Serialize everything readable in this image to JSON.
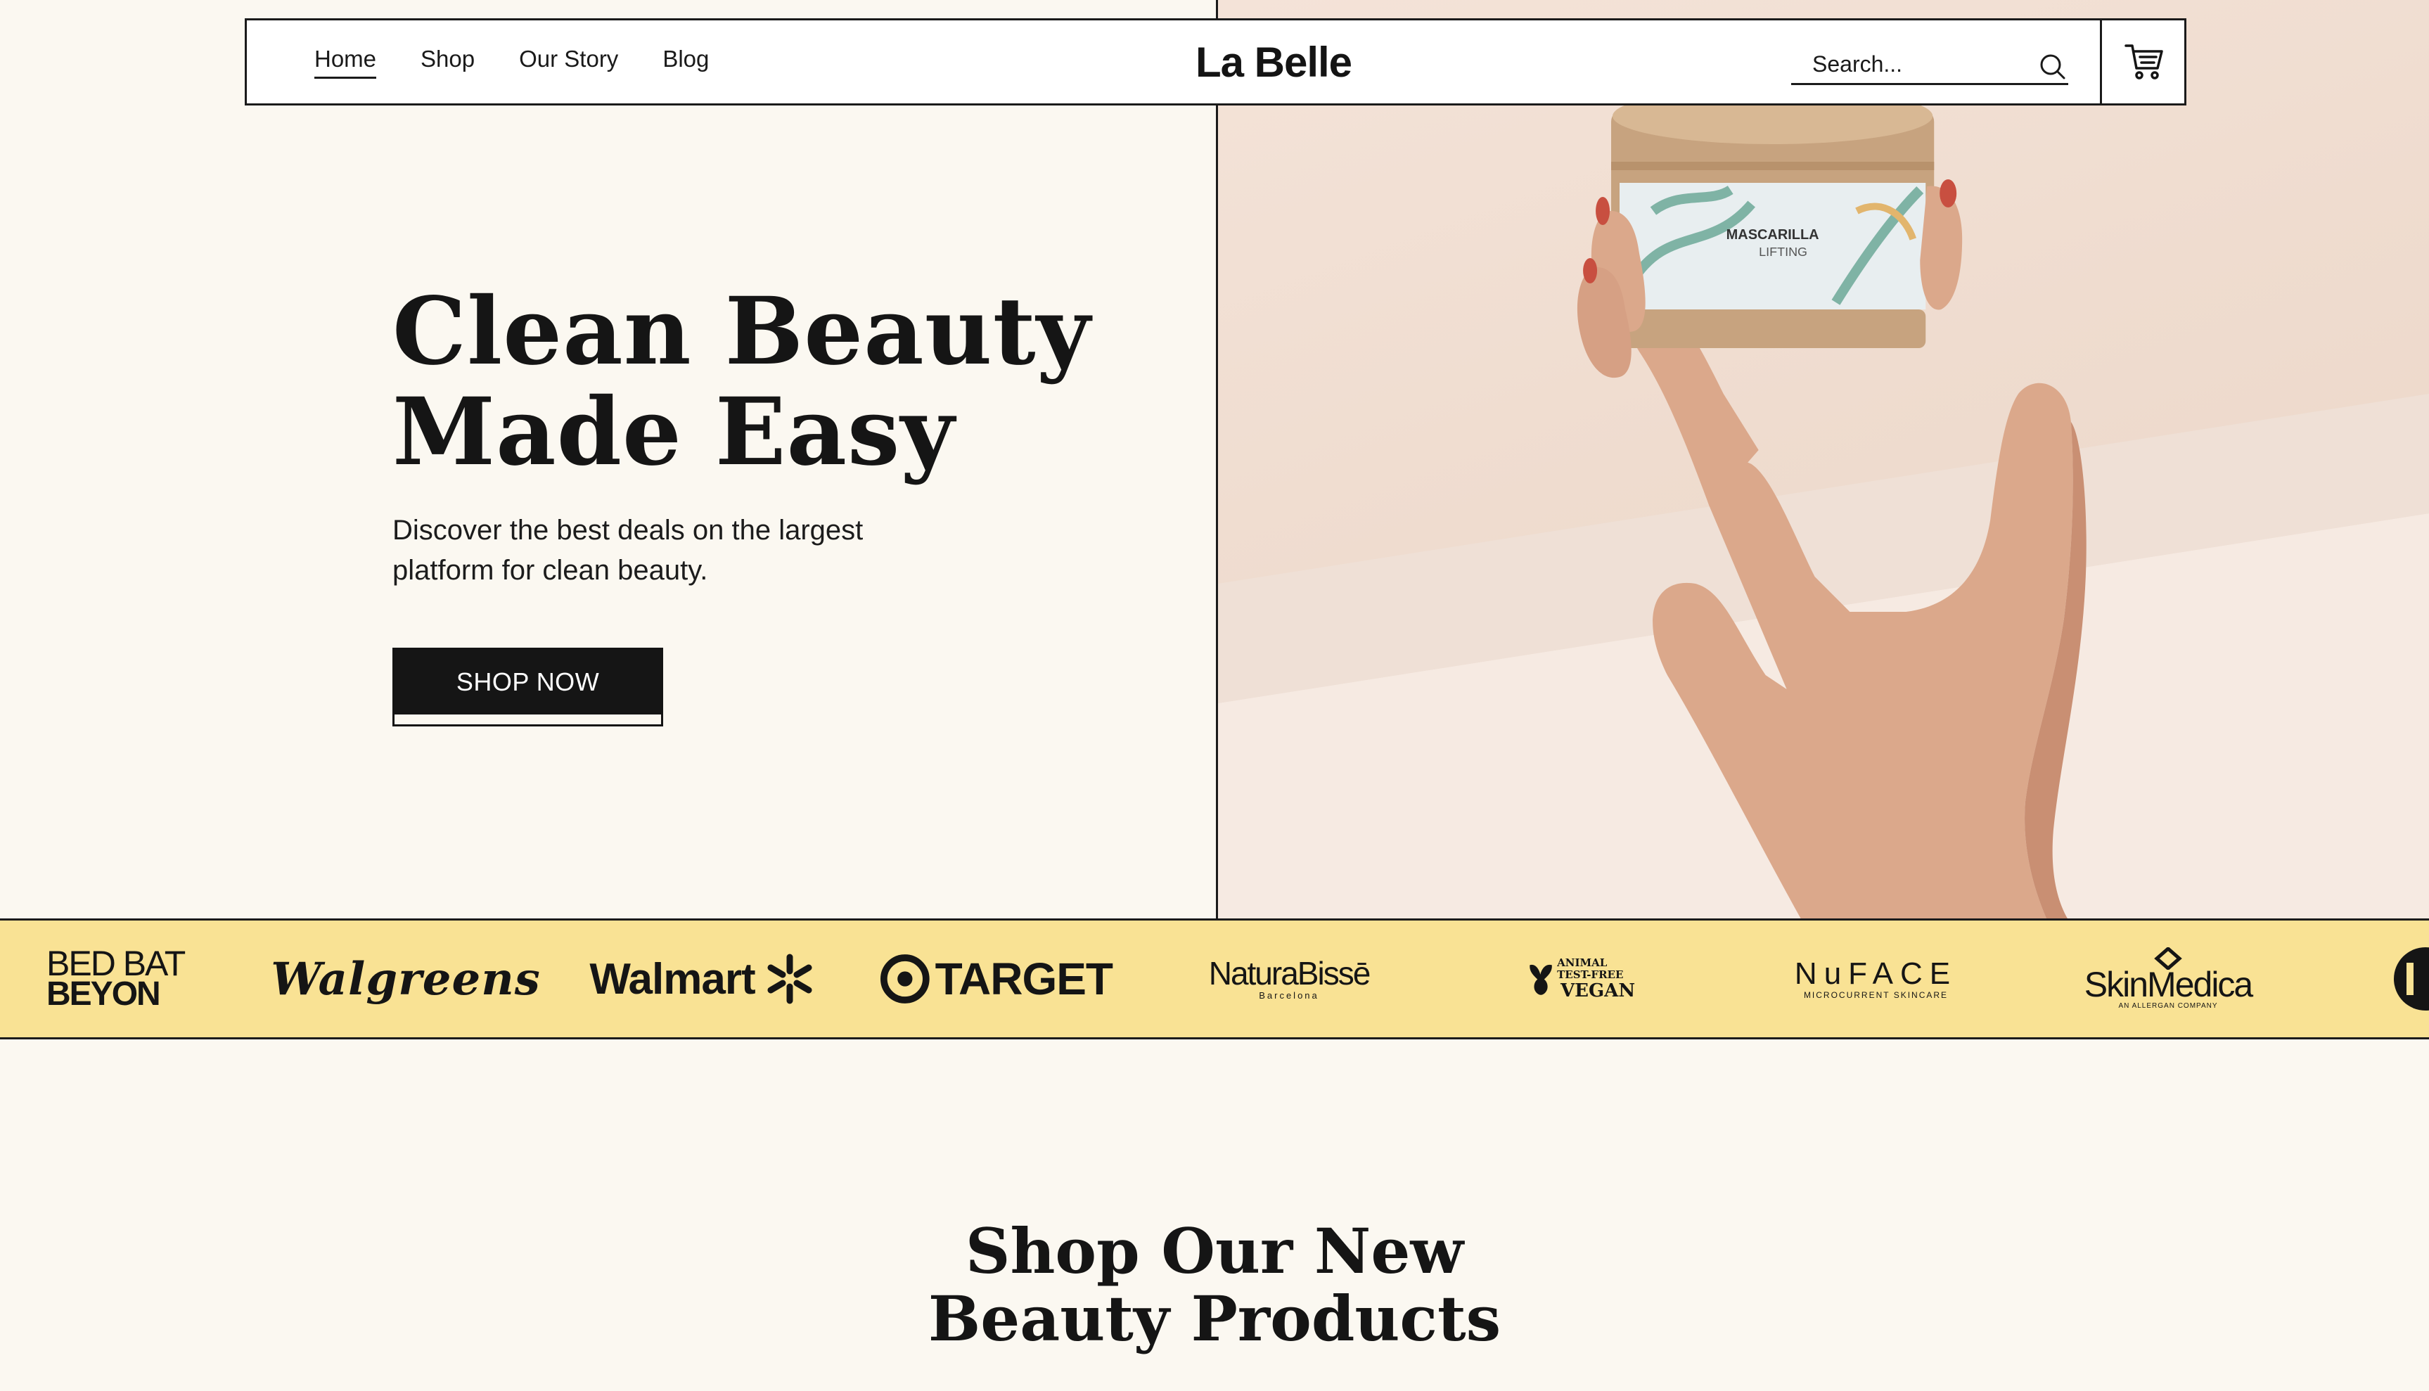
{
  "nav": {
    "links": [
      "Home",
      "Shop",
      "Our Story",
      "Blog"
    ],
    "active_link": "Home",
    "logo": "La Belle",
    "search_placeholder": "Search..."
  },
  "hero": {
    "title_line1": "Clean Beauty",
    "title_line2": "Made Easy",
    "subtitle": "Discover the best deals on the largest platform for clean beauty.",
    "cta_label": "SHOP NOW",
    "product_label_line1": "MASCARILLA",
    "product_label_line2": "LIFTING"
  },
  "brands": {
    "bbb_line1": "BED BAT",
    "bbb_line2": "BEYON",
    "walgreens": "Walgreens",
    "walmart": "Walmart",
    "target": "TARGET",
    "natura": "NaturaBissē",
    "natura_sub": "Barcelona",
    "vegan_line1": "ANIMAL TEST-FREE",
    "vegan_line2": "VEGAN",
    "nuface": "NuFACE",
    "nuface_sub": "MICROCURRENT SKINCARE",
    "skinmedica": "SkinMedica",
    "skinmedica_sub": "AN ALLERGAN COMPANY"
  },
  "products": {
    "heading_line1": "Shop Our New",
    "heading_line2": "Beauty Products"
  },
  "colors": {
    "page_bg": "#fbf8f1",
    "brand_strip_bg": "#f9e294",
    "ink": "#141414",
    "hero_photo_bg": "#f0dccf"
  }
}
